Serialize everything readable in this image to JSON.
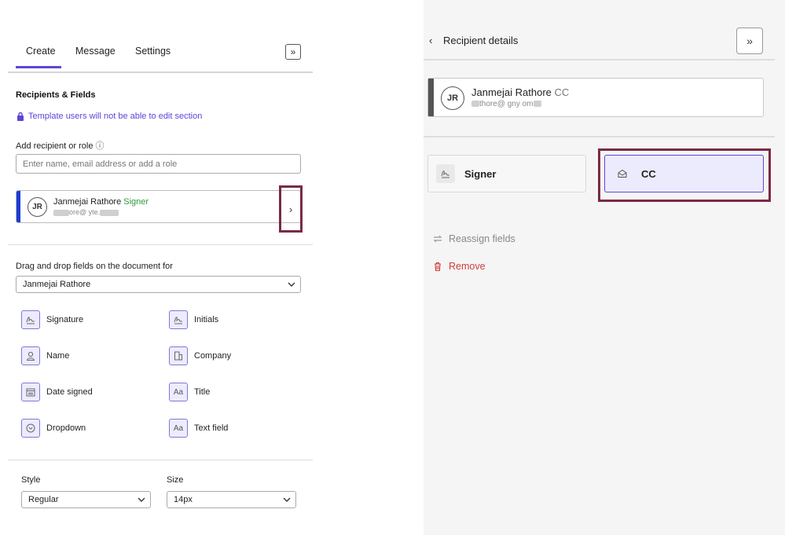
{
  "left": {
    "tabs": [
      {
        "label": "Create",
        "active": true
      },
      {
        "label": "Message",
        "active": false
      },
      {
        "label": "Settings",
        "active": false
      }
    ],
    "collapse_icon": "double-chevron-right-icon",
    "section_title": "Recipients & Fields",
    "lock_note": "Template users will not be able to edit section",
    "add_recipient_label": "Add recipient or role",
    "info_icon": "ⓘ",
    "search_placeholder": "Enter name, email address or add a role",
    "recipient": {
      "initials": "JR",
      "name": "Janmejai Rathore",
      "role": "Signer",
      "email_visible": "ore@ yte."
    },
    "drag_label": "Drag and drop fields on the document for",
    "drag_select_value": "Janmejai Rathore",
    "fields": [
      {
        "label": "Signature",
        "icon": "signature-icon"
      },
      {
        "label": "Initials",
        "icon": "initials-icon"
      },
      {
        "label": "Name",
        "icon": "person-icon"
      },
      {
        "label": "Company",
        "icon": "building-icon"
      },
      {
        "label": "Date signed",
        "icon": "calendar-icon"
      },
      {
        "label": "Title",
        "icon": "text-aa-icon",
        "glyph": "Aa"
      },
      {
        "label": "Dropdown",
        "icon": "dropdown-circle-icon"
      },
      {
        "label": "Text field",
        "icon": "text-aa-icon",
        "glyph": "Aa"
      }
    ],
    "style_label": "Style",
    "style_value": "Regular",
    "size_label": "Size",
    "size_value": "14px"
  },
  "right": {
    "back_icon": "‹",
    "title": "Recipient details",
    "collapse_icon": "double-chevron-right-icon",
    "recipient": {
      "initials": "JR",
      "name": "Janmejai Rathore",
      "role": "CC",
      "email_visible": "thore@ gny om"
    },
    "roles": [
      {
        "label": "Signer",
        "icon": "signature-icon",
        "selected": false
      },
      {
        "label": "CC",
        "icon": "envelope-open-icon",
        "selected": true
      }
    ],
    "reassign_label": "Reassign fields",
    "remove_label": "Remove"
  },
  "colors": {
    "accent": "#5b47d6",
    "signer_stripe": "#1d3bd1",
    "signer_role": "#2e9b3a",
    "highlight_box": "#7a2a45",
    "remove": "#d23b3b",
    "cc_selected_bg": "#eceafd"
  }
}
